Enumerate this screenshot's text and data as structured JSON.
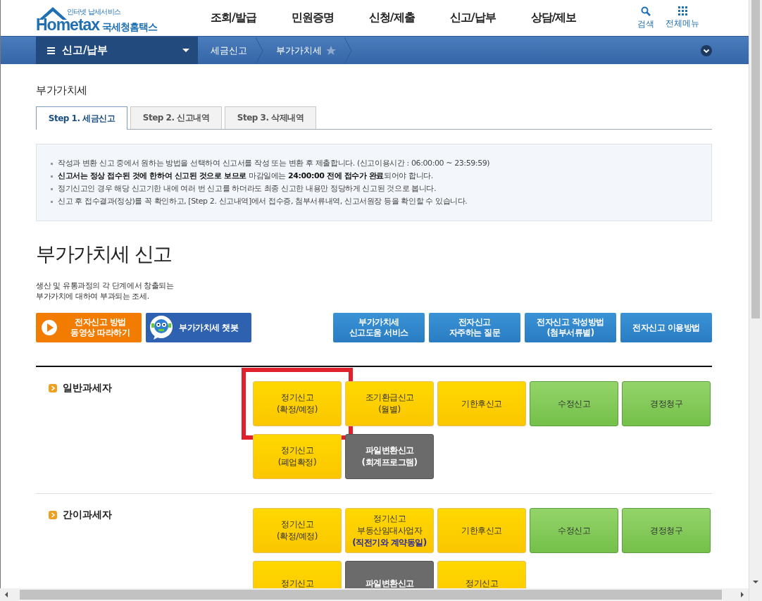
{
  "logo": {
    "tagline": "인터넷 납세서비스",
    "name": "Hometax",
    "korean": "국세청홈택스"
  },
  "nav": [
    "조회/발급",
    "민원증명",
    "신청/제출",
    "신고/납부",
    "상담/제보"
  ],
  "utility": [
    {
      "kind": "search",
      "label": "검색"
    },
    {
      "kind": "grid",
      "label": "전체메뉴"
    }
  ],
  "menu_bar": {
    "current": "신고/납부",
    "breadcrumbs": [
      {
        "label": "세금신고",
        "star": false
      },
      {
        "label": "부가가치세",
        "star": true
      }
    ]
  },
  "page_title": "부가가치세",
  "tabs": [
    {
      "label": "Step 1. 세금신고",
      "selected": true
    },
    {
      "label": "Step 2. 신고내역",
      "selected": false
    },
    {
      "label": "Step 3. 삭제내역",
      "selected": false
    }
  ],
  "notice": [
    "작성과 변환 신고 중에서 원하는 방법을 선택하여 신고서를 작성 또는 변환 후 제출합니다. (신고이용시간 : 06:00:00 ~ 23:59:59)",
    "**신고서는 정상 접수된 것에 한하여 신고된 것으로 보므로** 마감일에는 **24:00:00 전에 접수가 완료**되어야 합니다.",
    "정기신고인 경우 해당 신고기한 내에 여러 번 신고를 하더라도 최종 신고한 내용만 정당하게 신고된 것으로 봅니다.",
    "신고 후 접수결과(정상)를 꼭 확인하고, [Step 2. 신고내역]에서 접수증, 첨부서류내역, 신고서원장 등을 확인할 수 있습니다."
  ],
  "heading": "부가가치세 신고",
  "description": [
    "생산 및 유통과정의 각 단계에서 창출되는",
    "부가가치에 대하여 부과되는 조세."
  ],
  "guide_buttons": [
    {
      "kind": "video",
      "lines": [
        "전자신고 방법",
        "동영상 따라하기"
      ]
    },
    {
      "kind": "chatbot",
      "lines": [
        "부가가치세 챗봇"
      ]
    },
    {
      "kind": "info",
      "lines": [
        "부가가치세",
        "신고도움 서비스"
      ]
    },
    {
      "kind": "info",
      "lines": [
        "전자신고",
        "자주하는 질문"
      ]
    },
    {
      "kind": "info",
      "lines": [
        "전자신고 작성방법",
        "(첨부서류별)"
      ]
    },
    {
      "kind": "info",
      "lines": [
        "전자신고 이용방법"
      ]
    }
  ],
  "taxpayer_groups": [
    {
      "title": "일반과세자",
      "buttons": [
        {
          "kind": "yellow",
          "lines": [
            "정기신고",
            "(확정/예정)"
          ],
          "highlighted": true
        },
        {
          "kind": "yellow",
          "lines": [
            "조기환급신고",
            "(월별)"
          ],
          "highlighted": false
        },
        {
          "kind": "yellow",
          "lines": [
            "기한후신고"
          ],
          "highlighted": false
        },
        {
          "kind": "green",
          "lines": [
            "수정신고"
          ],
          "highlighted": false
        },
        {
          "kind": "green",
          "lines": [
            "경정청구"
          ],
          "highlighted": false
        },
        {
          "kind": "yellow",
          "lines": [
            "정기신고",
            "(폐업확정)"
          ],
          "highlighted": false
        },
        {
          "kind": "gray",
          "lines": [
            "파일변환신고",
            "(회계프로그램)"
          ],
          "highlighted": false
        }
      ]
    },
    {
      "title": "간이과세자",
      "buttons": [
        {
          "kind": "yellow",
          "lines": [
            "정기신고",
            "(확정/예정)"
          ],
          "highlighted": false
        },
        {
          "kind": "yellow",
          "lines": [
            "정기신고",
            "부동산임대사업자"
          ],
          "note": "(직전기와 계약동일)",
          "highlighted": false
        },
        {
          "kind": "yellow",
          "lines": [
            "기한후신고"
          ],
          "highlighted": false
        },
        {
          "kind": "green",
          "lines": [
            "수정신고"
          ],
          "highlighted": false
        },
        {
          "kind": "green",
          "lines": [
            "경정청구"
          ],
          "highlighted": false
        },
        {
          "kind": "yellow",
          "lines": [
            "정기신고"
          ],
          "highlighted": false
        },
        {
          "kind": "gray",
          "lines": [
            "파일변환신고"
          ],
          "highlighted": false
        },
        {
          "kind": "yellow",
          "lines": [
            "정기신고"
          ],
          "highlighted": false
        }
      ]
    }
  ]
}
